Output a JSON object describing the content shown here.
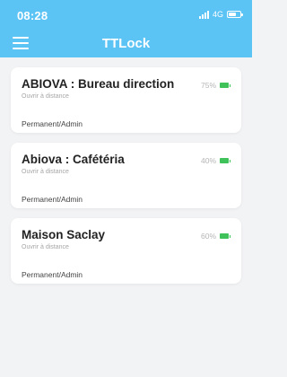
{
  "status": {
    "time": "08:28",
    "network": "4G"
  },
  "nav": {
    "title": "TTLock"
  },
  "locks": [
    {
      "name": "ABIOVA : Bureau direction",
      "subtitle": "Ouvrir à distance",
      "permission": "Permanent/Admin",
      "battery": "75%"
    },
    {
      "name": "Abiova : Cafétéria",
      "subtitle": "Ouvrir à distance",
      "permission": "Permanent/Admin",
      "battery": "40%"
    },
    {
      "name": "Maison Saclay",
      "subtitle": "Ouvrir à distance",
      "permission": "Permanent/Admin",
      "battery": "60%"
    }
  ],
  "colors": {
    "header": "#5cc3f5",
    "battery": "#3fc25a",
    "background": "#f2f3f5"
  },
  "icons": {
    "menu": "hamburger-menu-icon",
    "signal": "signal-icon",
    "phone_battery": "battery-icon",
    "lock_battery": "lock-battery-icon"
  }
}
